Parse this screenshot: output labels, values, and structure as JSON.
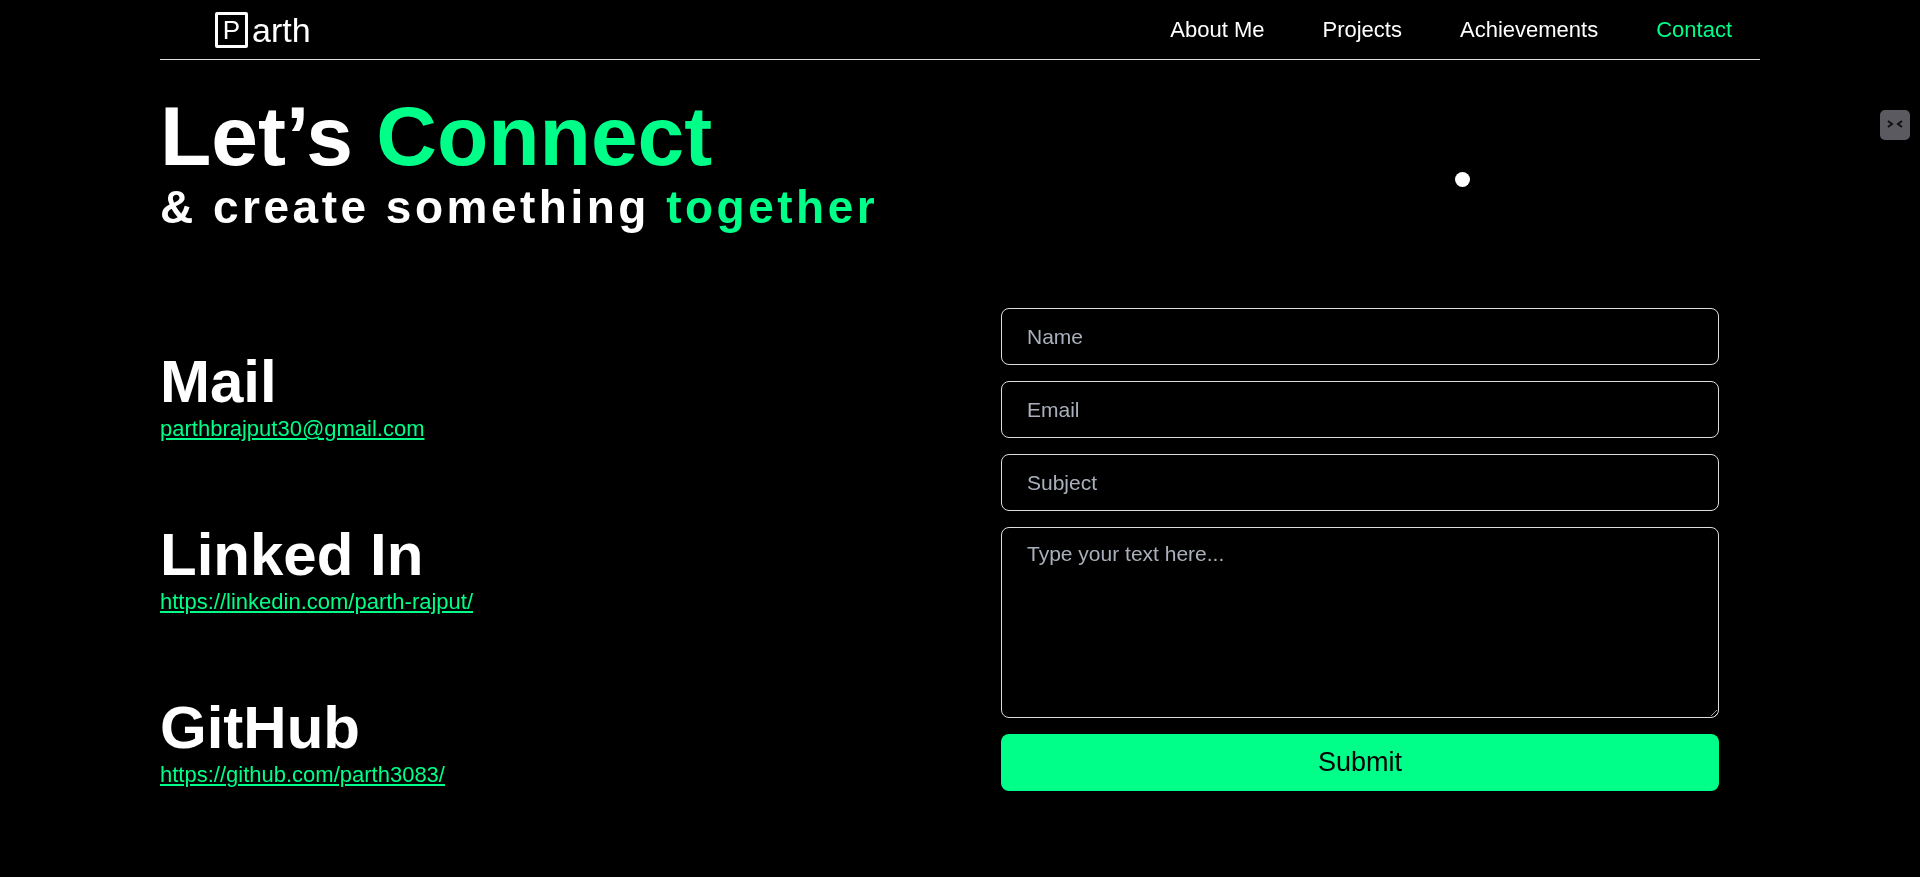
{
  "nav": {
    "logo": {
      "boxed": "P",
      "rest": "arth"
    },
    "links": [
      {
        "label": "About Me",
        "selected": false
      },
      {
        "label": "Projects",
        "selected": false
      },
      {
        "label": "Achievements",
        "selected": false
      },
      {
        "label": "Contact",
        "selected": true
      }
    ]
  },
  "hero": {
    "title": [
      {
        "text": "Let’s ",
        "accent": false
      },
      {
        "text": "Connect",
        "accent": true
      }
    ],
    "subtitle": [
      {
        "text": "& create something ",
        "accent": false
      },
      {
        "text": "together",
        "accent": true
      }
    ]
  },
  "contacts": [
    {
      "heading": "Mail",
      "link": "parthbrajput30@gmail.com"
    },
    {
      "heading": "Linked In",
      "link": "https://linkedin.com/parth-rajput/"
    },
    {
      "heading": "GitHub",
      "link": "https://github.com/parth3083/"
    }
  ],
  "form": {
    "fields": [
      {
        "kind": "input",
        "placeholder": "Name"
      },
      {
        "kind": "input",
        "placeholder": "Email"
      },
      {
        "kind": "input",
        "placeholder": "Subject"
      },
      {
        "kind": "textarea",
        "placeholder": "Type your text here..."
      }
    ],
    "submit": "Submit"
  }
}
